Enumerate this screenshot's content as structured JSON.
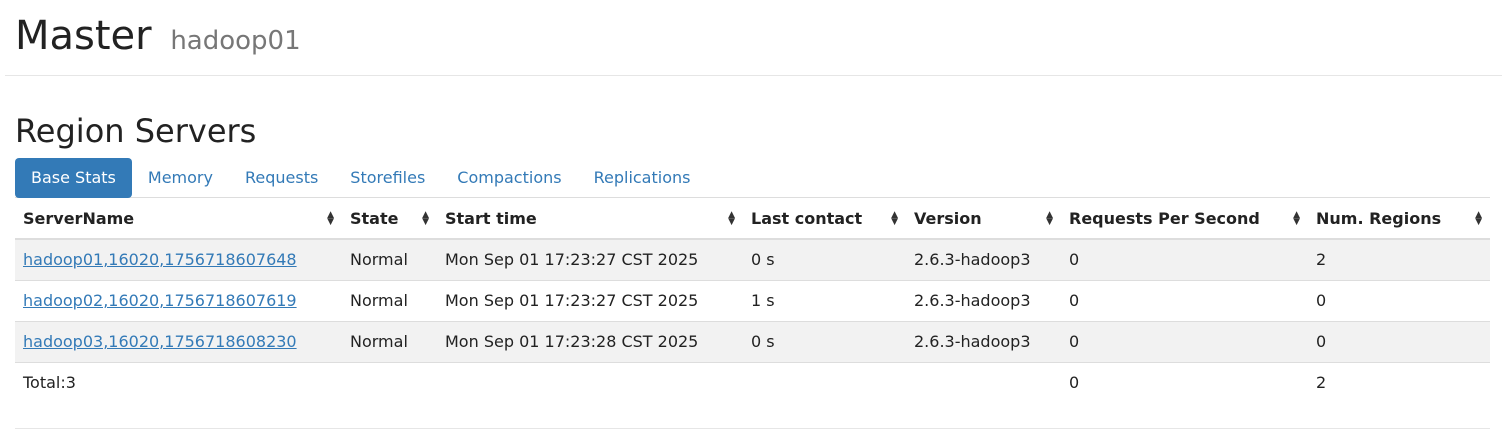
{
  "header": {
    "title": "Master",
    "subtitle": "hadoop01"
  },
  "section": {
    "title": "Region Servers"
  },
  "tabs": [
    {
      "label": "Base Stats",
      "active": true
    },
    {
      "label": "Memory",
      "active": false
    },
    {
      "label": "Requests",
      "active": false
    },
    {
      "label": "Storefiles",
      "active": false
    },
    {
      "label": "Compactions",
      "active": false
    },
    {
      "label": "Replications",
      "active": false
    }
  ],
  "table": {
    "columns": [
      "ServerName",
      "State",
      "Start time",
      "Last contact",
      "Version",
      "Requests Per Second",
      "Num. Regions"
    ],
    "rows": [
      [
        "hadoop01,16020,1756718607648",
        "Normal",
        "Mon Sep 01 17:23:27 CST 2025",
        "0 s",
        "2.6.3-hadoop3",
        "0",
        "2"
      ],
      [
        "hadoop02,16020,1756718607619",
        "Normal",
        "Mon Sep 01 17:23:27 CST 2025",
        "1 s",
        "2.6.3-hadoop3",
        "0",
        "0"
      ],
      [
        "hadoop03,16020,1756718608230",
        "Normal",
        "Mon Sep 01 17:23:28 CST 2025",
        "0 s",
        "2.6.3-hadoop3",
        "0",
        "0"
      ]
    ],
    "total": {
      "label": "Total:3",
      "requests_per_second": "0",
      "num_regions": "2"
    }
  },
  "colors": {
    "accent": "#337ab7",
    "stripe": "#f2f2f2",
    "border": "#dddddd"
  },
  "icons": {
    "sort": "sort-both-icon"
  }
}
